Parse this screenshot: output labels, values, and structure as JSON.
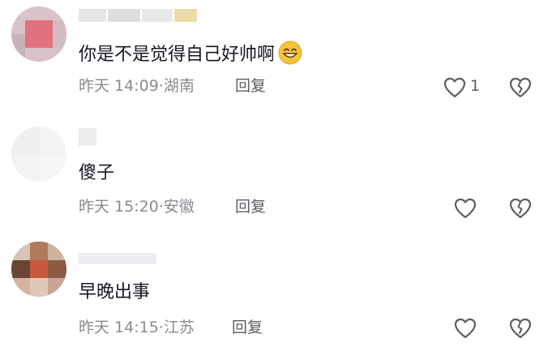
{
  "comments": [
    {
      "text": "你是不是觉得自己好帅啊",
      "emoji": "grinning-sweat-emoji",
      "time": "昨天 14:09",
      "location": "湖南",
      "reply_label": "回复",
      "like_count": "1"
    },
    {
      "text": "傻子",
      "time": "昨天 15:20",
      "location": "安徽",
      "reply_label": "回复",
      "like_count": ""
    },
    {
      "text": "早晚出事",
      "time": "昨天 14:15",
      "location": "江苏",
      "reply_label": "回复",
      "like_count": ""
    }
  ],
  "separator": "·",
  "icons": {
    "like": "heart-outline-icon",
    "dislike": "broken-heart-icon"
  },
  "colors": {
    "text": "#161823",
    "meta": "#8a8b91",
    "icon": "#5c5d63"
  }
}
